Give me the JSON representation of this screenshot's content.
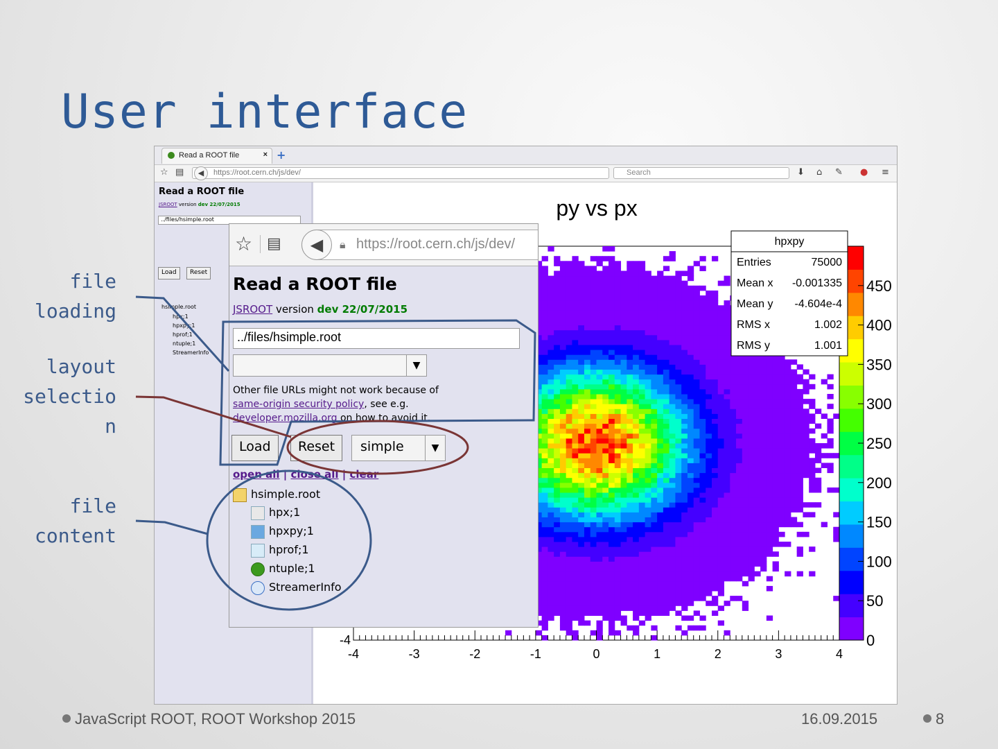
{
  "slide": {
    "title": "User interface",
    "callouts": {
      "file_loading": [
        "file",
        "loading"
      ],
      "layout_selection": [
        "layout",
        "selectio",
        "n"
      ],
      "file_content": [
        "file",
        "content"
      ]
    },
    "footer_left": "JavaScript ROOT, ROOT Workshop 2015",
    "footer_date": "16.09.2015",
    "page_number": "8"
  },
  "browser": {
    "tab_label": "Read a ROOT file",
    "url": "https://root.cern.ch/js/dev/",
    "search_placeholder": "Search"
  },
  "jsroot_page": {
    "title": "Read a ROOT file",
    "jsroot_link": "JSROOT",
    "version_text": "version",
    "version_date": "dev 22/07/2015",
    "file_input_value": "../files/hsimple.root",
    "note_text_1": "Other file URLs might not work because of",
    "note_link_1": "same-origin security policy",
    "note_text_2": ", see e.g.",
    "note_link_2": "developer.mozilla.org",
    "note_text_3": " on how to avoid it.",
    "load_label": "Load",
    "reset_label": "Reset",
    "layout_value": "simple",
    "open_all": "open all",
    "close_all": "close all",
    "clear": "clear",
    "tree": [
      {
        "name": "hsimple.root",
        "icon": "folder-icon"
      },
      {
        "name": "hpx;1",
        "icon": "histogram-1d-icon"
      },
      {
        "name": "hpxpy;1",
        "icon": "histogram-2d-icon"
      },
      {
        "name": "hprof;1",
        "icon": "profile-icon"
      },
      {
        "name": "ntuple;1",
        "icon": "tree-icon"
      },
      {
        "name": "StreamerInfo",
        "icon": "info-icon"
      }
    ]
  },
  "stats": {
    "name": "hpxpy",
    "rows": [
      {
        "label": "Entries",
        "value": "75000"
      },
      {
        "label": "Mean x",
        "value": "-0.001335"
      },
      {
        "label": "Mean y",
        "value": "-4.604e-4"
      },
      {
        "label": "RMS x",
        "value": "1.002"
      },
      {
        "label": "RMS y",
        "value": "1.001"
      }
    ]
  },
  "chart_data": {
    "type": "heatmap",
    "title": "py vs px",
    "xlim": [
      -4,
      4
    ],
    "ylim": [
      -4,
      4
    ],
    "x_ticks": [
      "-4",
      "-3",
      "-2",
      "-1",
      "0",
      "1",
      "2",
      "3",
      "4"
    ],
    "y_visible_ticks": [
      "-4"
    ],
    "z_range": [
      0,
      500
    ],
    "z_ticks": [
      "0",
      "50",
      "100",
      "150",
      "200",
      "250",
      "300",
      "350",
      "400",
      "450"
    ],
    "palette": [
      "#7f00ff",
      "#4400ff",
      "#0000ff",
      "#0044ff",
      "#0088ff",
      "#00ccff",
      "#00ffcc",
      "#00ff88",
      "#00ff44",
      "#44ff00",
      "#88ff00",
      "#ccff00",
      "#ffff00",
      "#ffcc00",
      "#ff8800",
      "#ff4400",
      "#ff0000"
    ],
    "distribution": {
      "mean_x": 0,
      "mean_y": 0,
      "sigma_x": 1.0,
      "sigma_y": 1.0,
      "peak": 470
    }
  }
}
